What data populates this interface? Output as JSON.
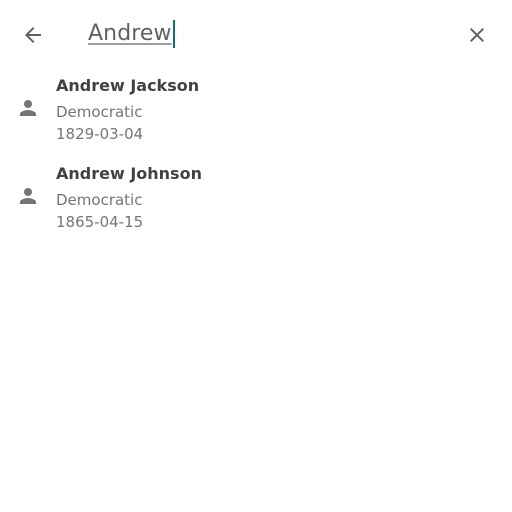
{
  "header": {
    "back_icon": "arrow-left-icon",
    "clear_icon": "close-icon",
    "search_query": "Andrew"
  },
  "results": [
    {
      "icon": "person-icon",
      "name": "Andrew Jackson",
      "party": "Democratic",
      "date": "1829-03-04"
    },
    {
      "icon": "person-icon",
      "name": "Andrew Johnson",
      "party": "Democratic",
      "date": "1865-04-15"
    }
  ],
  "colors": {
    "caret": "#00796b",
    "icon": "#616161",
    "text_primary": "#424242",
    "text_secondary": "#757575"
  }
}
